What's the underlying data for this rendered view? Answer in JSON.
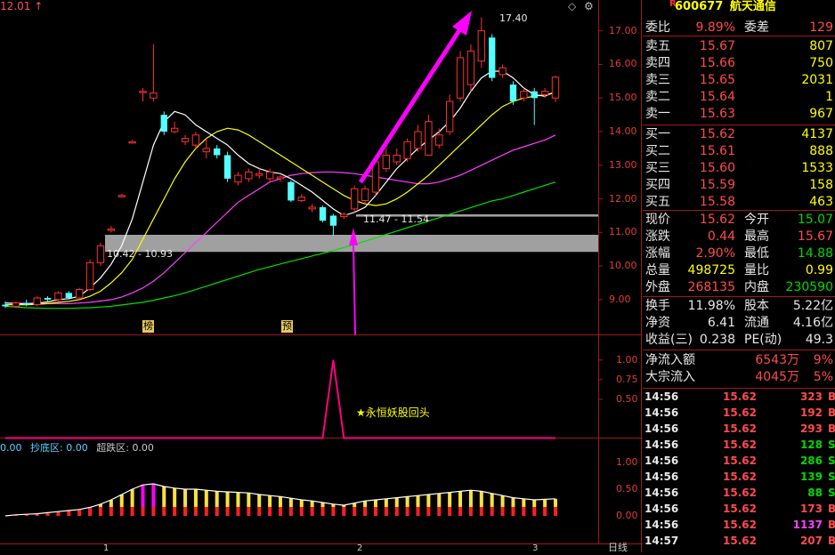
{
  "colors": {
    "up": "#ff3030",
    "down": "#54ffff",
    "ma5": "#ffffff",
    "ma10": "#ffff00",
    "ma20": "#ff40ff",
    "ma60": "#00e000",
    "highlight": "#a0a0a0",
    "signal": "#ff0080",
    "accent": "#ff00ff"
  },
  "header": {
    "left_value": "12.01",
    "left_arrow": "↑",
    "symbol_badge": "R",
    "symbol": "600677",
    "name": "航天通信"
  },
  "price_axis": {
    "ticks": [
      "17.00",
      "16.00",
      "15.00",
      "14.00",
      "13.00",
      "12.00",
      "11.00",
      "10.00",
      "9.00"
    ]
  },
  "signal_axis": {
    "ticks": [
      "1.00",
      "0.75",
      "0.50"
    ]
  },
  "osc_axis": {
    "ticks": [
      "1.00",
      "0.50",
      "0.00"
    ]
  },
  "annotations": {
    "peak": "17.40",
    "box_upper": "11.47 - 11.54",
    "box_lower": "10.42 - 10.93",
    "marker_bang": "榜",
    "marker_yu": "预",
    "signal_label": "永恒妖股回头",
    "signal_star": "★"
  },
  "osc_header": {
    "v1": "0.00",
    "name2": "抄底区:",
    "v2": "0.00",
    "name3": "超跌区:",
    "v3": "0.00"
  },
  "footer": {
    "tick1": "1",
    "tick2": "2",
    "tick3": "3",
    "period": "日线"
  },
  "window_icons": {
    "diamond": "◇",
    "gear": "⚙"
  },
  "quote": {
    "weibi": {
      "label": "委比",
      "value": "9.89%",
      "label2": "委差",
      "value2": "129"
    },
    "asks": [
      {
        "label": "卖五",
        "price": "15.67",
        "vol": "807"
      },
      {
        "label": "卖四",
        "price": "15.66",
        "vol": "750"
      },
      {
        "label": "卖三",
        "price": "15.65",
        "vol": "2031"
      },
      {
        "label": "卖二",
        "price": "15.64",
        "vol": "1"
      },
      {
        "label": "卖一",
        "price": "15.63",
        "vol": "967"
      }
    ],
    "bids": [
      {
        "label": "买一",
        "price": "15.62",
        "vol": "4137"
      },
      {
        "label": "买二",
        "price": "15.61",
        "vol": "888"
      },
      {
        "label": "买三",
        "price": "15.60",
        "vol": "1533"
      },
      {
        "label": "买四",
        "price": "15.59",
        "vol": "158"
      },
      {
        "label": "买五",
        "price": "15.58",
        "vol": "463"
      }
    ],
    "stats1": [
      {
        "l1": "现价",
        "v1": "15.62",
        "c1": "red",
        "l2": "今开",
        "v2": "15.07",
        "c2": "grn"
      },
      {
        "l1": "涨跌",
        "v1": "0.44",
        "c1": "red",
        "l2": "最高",
        "v2": "15.67",
        "c2": "red"
      },
      {
        "l1": "涨幅",
        "v1": "2.90%",
        "c1": "red",
        "l2": "最低",
        "v2": "14.88",
        "c2": "grn"
      },
      {
        "l1": "总量",
        "v1": "498725",
        "c1": "yel",
        "l2": "量比",
        "v2": "0.99",
        "c2": "yel"
      },
      {
        "l1": "外盘",
        "v1": "268135",
        "c1": "red",
        "l2": "内盘",
        "v2": "230590",
        "c2": "grn"
      }
    ],
    "stats2": [
      {
        "l1": "换手",
        "v1": "11.98%",
        "c1": "wht",
        "l2": "股本",
        "v2": "5.22亿",
        "c2": "wht"
      },
      {
        "l1": "净资",
        "v1": "6.41",
        "c1": "wht",
        "l2": "流通",
        "v2": "4.16亿",
        "c2": "wht"
      },
      {
        "l1": "收益(三)",
        "v1": "0.238",
        "c1": "wht",
        "l2": "PE(动)",
        "v2": "49.3",
        "c2": "wht"
      }
    ],
    "flows": [
      {
        "label": "净流入额",
        "value": "6543万",
        "extra": "9%"
      },
      {
        "label": "大宗流入",
        "value": "4045万",
        "extra": "5%"
      }
    ],
    "trades": [
      {
        "time": "14:56",
        "price": "15.62",
        "vol": "323",
        "vc": "red",
        "side": "B"
      },
      {
        "time": "14:56",
        "price": "15.62",
        "vol": "192",
        "vc": "red",
        "side": "B"
      },
      {
        "time": "14:56",
        "price": "15.62",
        "vol": "293",
        "vc": "red",
        "side": "B"
      },
      {
        "time": "14:56",
        "price": "15.62",
        "vol": "128",
        "vc": "grn",
        "side": "S"
      },
      {
        "time": "14:56",
        "price": "15.62",
        "vol": "286",
        "vc": "grn",
        "side": "S"
      },
      {
        "time": "14:56",
        "price": "15.62",
        "vol": "139",
        "vc": "grn",
        "side": "S"
      },
      {
        "time": "14:56",
        "price": "15.62",
        "vol": "88",
        "vc": "grn",
        "side": "S"
      },
      {
        "time": "14:56",
        "price": "15.62",
        "vol": "173",
        "vc": "red",
        "side": "B"
      },
      {
        "time": "14:56",
        "price": "15.62",
        "vol": "1137",
        "vc": "mag",
        "side": "B"
      },
      {
        "time": "14:57",
        "price": "15.62",
        "vol": "207",
        "vc": "red",
        "side": "B"
      }
    ]
  },
  "chart_data": [
    {
      "type": "candlestick",
      "title": "",
      "ylim": [
        8.6,
        17.6
      ],
      "series_names": [
        "K",
        "MA5",
        "MA10",
        "MA20",
        "MA60"
      ],
      "candles": [
        {
          "o": 8.85,
          "c": 8.8,
          "h": 8.95,
          "l": 8.75
        },
        {
          "o": 8.8,
          "c": 8.9,
          "h": 8.95,
          "l": 8.75
        },
        {
          "o": 8.9,
          "c": 8.85,
          "h": 9.0,
          "l": 8.8
        },
        {
          "o": 8.85,
          "c": 9.05,
          "h": 9.1,
          "l": 8.8
        },
        {
          "o": 9.05,
          "c": 9.0,
          "h": 9.1,
          "l": 8.95
        },
        {
          "o": 9.0,
          "c": 9.2,
          "h": 9.25,
          "l": 8.95
        },
        {
          "o": 9.2,
          "c": 9.05,
          "h": 9.25,
          "l": 9.0
        },
        {
          "o": 9.05,
          "c": 9.3,
          "h": 9.35,
          "l": 9.0
        },
        {
          "o": 9.3,
          "c": 10.1,
          "h": 10.2,
          "l": 9.25
        },
        {
          "o": 10.1,
          "c": 10.6,
          "h": 10.7,
          "l": 10.0
        },
        {
          "o": 11.1,
          "c": 11.1,
          "h": 11.2,
          "l": 11.0
        },
        {
          "o": 12.1,
          "c": 12.1,
          "h": 12.15,
          "l": 12.05
        },
        {
          "o": 13.7,
          "c": 13.7,
          "h": 13.75,
          "l": 13.65
        },
        {
          "o": 15.2,
          "c": 15.2,
          "h": 15.3,
          "l": 14.9
        },
        {
          "o": 15.0,
          "c": 15.15,
          "h": 16.6,
          "l": 14.9
        },
        {
          "o": 14.5,
          "c": 14.0,
          "h": 14.6,
          "l": 13.9
        },
        {
          "o": 14.0,
          "c": 14.1,
          "h": 14.3,
          "l": 13.95
        },
        {
          "o": 13.7,
          "c": 13.8,
          "h": 13.9,
          "l": 13.6
        },
        {
          "o": 13.6,
          "c": 13.9,
          "h": 14.0,
          "l": 13.5
        },
        {
          "o": 13.4,
          "c": 13.5,
          "h": 13.8,
          "l": 13.2
        },
        {
          "o": 13.5,
          "c": 13.3,
          "h": 13.6,
          "l": 13.2
        },
        {
          "o": 13.3,
          "c": 12.6,
          "h": 13.4,
          "l": 12.5
        },
        {
          "o": 12.5,
          "c": 12.7,
          "h": 12.8,
          "l": 12.4
        },
        {
          "o": 12.6,
          "c": 12.8,
          "h": 12.9,
          "l": 12.5
        },
        {
          "o": 12.7,
          "c": 12.75,
          "h": 12.9,
          "l": 12.6
        },
        {
          "o": 12.6,
          "c": 12.8,
          "h": 12.9,
          "l": 12.5
        },
        {
          "o": 12.6,
          "c": 12.65,
          "h": 12.7,
          "l": 12.5
        },
        {
          "o": 12.5,
          "c": 11.95,
          "h": 12.55,
          "l": 11.9
        },
        {
          "o": 11.95,
          "c": 12.05,
          "h": 12.15,
          "l": 11.9
        },
        {
          "o": 11.7,
          "c": 11.75,
          "h": 11.85,
          "l": 11.6
        },
        {
          "o": 11.75,
          "c": 11.35,
          "h": 11.8,
          "l": 11.3
        },
        {
          "o": 11.5,
          "c": 11.2,
          "h": 11.55,
          "l": 10.9
        },
        {
          "o": 11.47,
          "c": 11.54,
          "h": 11.6,
          "l": 11.4
        },
        {
          "o": 11.7,
          "c": 12.3,
          "h": 12.4,
          "l": 11.6
        },
        {
          "o": 11.95,
          "c": 12.3,
          "h": 12.4,
          "l": 11.85
        },
        {
          "o": 12.2,
          "c": 13.1,
          "h": 13.2,
          "l": 12.1
        },
        {
          "o": 12.9,
          "c": 13.3,
          "h": 13.5,
          "l": 12.8
        },
        {
          "o": 13.1,
          "c": 13.3,
          "h": 13.5,
          "l": 13.0
        },
        {
          "o": 13.2,
          "c": 13.7,
          "h": 13.8,
          "l": 13.1
        },
        {
          "o": 13.5,
          "c": 14.0,
          "h": 14.2,
          "l": 13.4
        },
        {
          "o": 13.3,
          "c": 14.3,
          "h": 14.5,
          "l": 13.3
        },
        {
          "o": 13.6,
          "c": 13.9,
          "h": 14.1,
          "l": 13.5
        },
        {
          "o": 14.0,
          "c": 14.9,
          "h": 15.1,
          "l": 13.9
        },
        {
          "o": 15.0,
          "c": 16.2,
          "h": 16.4,
          "l": 14.9
        },
        {
          "o": 15.4,
          "c": 16.4,
          "h": 16.6,
          "l": 15.2
        },
        {
          "o": 16.1,
          "c": 17.0,
          "h": 17.4,
          "l": 15.9
        },
        {
          "o": 16.8,
          "c": 15.6,
          "h": 16.9,
          "l": 15.5
        },
        {
          "o": 15.7,
          "c": 15.9,
          "h": 16.0,
          "l": 15.6
        },
        {
          "o": 15.4,
          "c": 14.9,
          "h": 15.5,
          "l": 14.8
        },
        {
          "o": 15.0,
          "c": 15.2,
          "h": 15.3,
          "l": 14.9
        },
        {
          "o": 15.2,
          "c": 15.0,
          "h": 15.3,
          "l": 14.2
        },
        {
          "o": 15.1,
          "c": 15.2,
          "h": 15.3,
          "l": 15.0
        },
        {
          "o": 15.0,
          "c": 15.62,
          "h": 15.67,
          "l": 14.88
        }
      ],
      "ma5": [
        8.9,
        8.88,
        8.87,
        8.9,
        8.93,
        9.0,
        9.03,
        9.1,
        9.35,
        9.65,
        10.05,
        10.6,
        11.4,
        12.5,
        13.6,
        14.3,
        14.6,
        14.5,
        14.2,
        14.0,
        13.8,
        13.6,
        13.3,
        13.05,
        12.9,
        12.8,
        12.75,
        12.6,
        12.4,
        12.2,
        11.95,
        11.7,
        11.5,
        11.6,
        11.75,
        12.1,
        12.5,
        12.9,
        13.2,
        13.5,
        13.75,
        14.0,
        14.3,
        14.7,
        15.2,
        15.6,
        15.8,
        15.8,
        15.6,
        15.3,
        15.1,
        15.05,
        15.2
      ],
      "ma10": [
        8.85,
        8.85,
        8.85,
        8.86,
        8.88,
        8.92,
        8.95,
        9.0,
        9.1,
        9.25,
        9.5,
        9.8,
        10.2,
        10.8,
        11.4,
        12.0,
        12.6,
        13.1,
        13.5,
        13.8,
        14.0,
        14.1,
        14.05,
        13.9,
        13.7,
        13.5,
        13.3,
        13.1,
        12.9,
        12.7,
        12.5,
        12.3,
        12.1,
        11.95,
        11.85,
        11.8,
        11.85,
        12.0,
        12.2,
        12.45,
        12.7,
        13.0,
        13.3,
        13.6,
        13.9,
        14.2,
        14.5,
        14.75,
        14.9,
        15.0,
        15.05,
        15.1,
        15.15
      ],
      "ma20": [
        8.9,
        8.9,
        8.89,
        8.89,
        8.88,
        8.88,
        8.88,
        8.9,
        8.92,
        8.96,
        9.0,
        9.08,
        9.2,
        9.35,
        9.55,
        9.8,
        10.1,
        10.4,
        10.7,
        11.0,
        11.3,
        11.6,
        11.9,
        12.1,
        12.3,
        12.5,
        12.6,
        12.7,
        12.75,
        12.78,
        12.8,
        12.8,
        12.78,
        12.75,
        12.7,
        12.65,
        12.6,
        12.55,
        12.5,
        12.45,
        12.45,
        12.5,
        12.6,
        12.7,
        12.85,
        13.0,
        13.15,
        13.3,
        13.45,
        13.55,
        13.65,
        13.75,
        13.9
      ],
      "ma60": [
        8.8,
        8.78,
        8.76,
        8.75,
        8.74,
        8.74,
        8.74,
        8.75,
        8.76,
        8.78,
        8.8,
        8.84,
        8.88,
        8.92,
        8.98,
        9.05,
        9.12,
        9.2,
        9.3,
        9.4,
        9.5,
        9.6,
        9.7,
        9.8,
        9.9,
        9.98,
        10.06,
        10.14,
        10.22,
        10.3,
        10.38,
        10.46,
        10.55,
        10.64,
        10.74,
        10.84,
        10.94,
        11.04,
        11.14,
        11.24,
        11.34,
        11.44,
        11.54,
        11.64,
        11.74,
        11.84,
        11.94,
        12.0,
        12.1,
        12.2,
        12.3,
        12.4,
        12.5
      ]
    },
    {
      "type": "line",
      "title": "",
      "ylim": [
        0,
        1.1
      ],
      "values": [
        0,
        0,
        0,
        0,
        0,
        0,
        0,
        0,
        0,
        0,
        0,
        0,
        0,
        0,
        0,
        0,
        0,
        0,
        0,
        0,
        0,
        0,
        0,
        0,
        0,
        0,
        0,
        0,
        0,
        0,
        0,
        1,
        0,
        0,
        0,
        0,
        0,
        0,
        0,
        0,
        0,
        0,
        0,
        0,
        0,
        0,
        0,
        0,
        0,
        0,
        0,
        0,
        0
      ]
    },
    {
      "type": "bar",
      "title": "",
      "ylim": [
        0,
        1.3
      ],
      "values": [
        0.0,
        0.02,
        0.03,
        0.04,
        0.06,
        0.08,
        0.1,
        0.12,
        0.16,
        0.22,
        0.3,
        0.4,
        0.5,
        0.58,
        0.6,
        0.55,
        0.52,
        0.5,
        0.5,
        0.48,
        0.46,
        0.45,
        0.44,
        0.43,
        0.4,
        0.38,
        0.36,
        0.33,
        0.3,
        0.28,
        0.25,
        0.22,
        0.2,
        0.24,
        0.28,
        0.3,
        0.32,
        0.34,
        0.36,
        0.38,
        0.4,
        0.42,
        0.44,
        0.46,
        0.48,
        0.46,
        0.42,
        0.38,
        0.34,
        0.32,
        0.3,
        0.31,
        0.32
      ]
    }
  ]
}
